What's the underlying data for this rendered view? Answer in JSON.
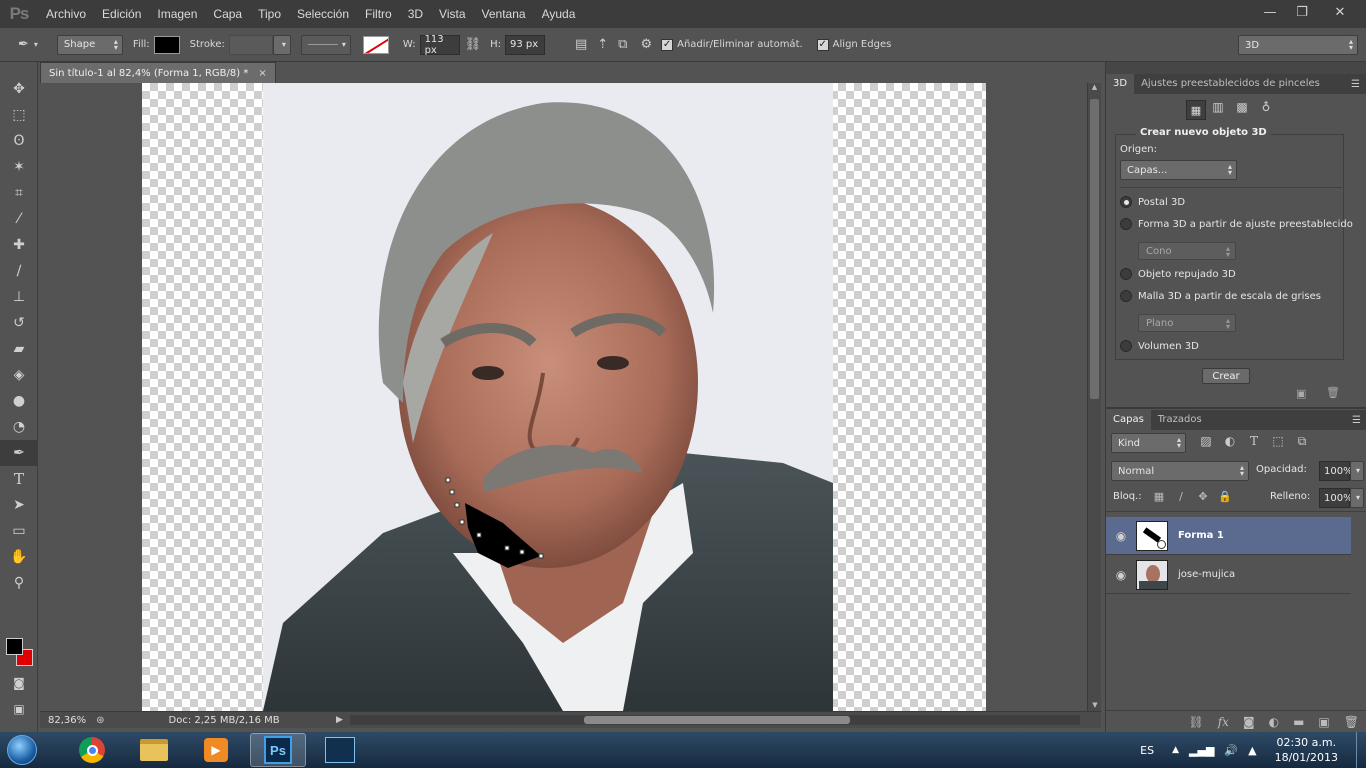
{
  "app": {
    "logo": "Ps"
  },
  "menu": [
    "Archivo",
    "Edición",
    "Imagen",
    "Capa",
    "Tipo",
    "Selección",
    "Filtro",
    "3D",
    "Vista",
    "Ventana",
    "Ayuda"
  ],
  "window_controls": {
    "minimize": "—",
    "restore": "❐",
    "close": "✕"
  },
  "options": {
    "mode": "Shape",
    "fill_label": "Fill:",
    "stroke_label": "Stroke:",
    "w_label": "W:",
    "w_value": "113 px",
    "h_label": "H:",
    "h_value": "93 px",
    "auto_add_label": "Añadir/Eliminar automát.",
    "align_edges_label": "Align Edges",
    "workspace": "3D",
    "fill_color": "#000000"
  },
  "document": {
    "tab_title": "Sin título-1 al 82,4% (Forma 1, RGB/8) *",
    "tab_close": "×",
    "zoom": "82,36%",
    "doc_info": "Doc: 2,25 MB/2,16 MB"
  },
  "colors": {
    "foreground": "#000000",
    "background": "#e00000",
    "accent": "#5b6a8f"
  },
  "panel3d": {
    "tabs": [
      "3D",
      "Ajustes preestablecidos de pinceles"
    ],
    "section_title": "Crear nuevo objeto 3D",
    "origin_label": "Origen:",
    "origin_value": "Capas...",
    "options": [
      {
        "label": "Postal 3D",
        "selected": true
      },
      {
        "label": "Forma 3D a partir de ajuste preestablecido",
        "selected": false
      },
      {
        "label": "Objeto repujado 3D",
        "selected": false
      },
      {
        "label": "Malla 3D a partir de escala de grises",
        "selected": false
      },
      {
        "label": "Volumen 3D",
        "selected": false
      }
    ],
    "preset_value": "Cono",
    "mesh_value": "Plano",
    "create_button": "Crear"
  },
  "layers": {
    "tabs": [
      "Capas",
      "Trazados"
    ],
    "kind": "Kind",
    "blend_mode": "Normal",
    "opacity_label": "Opacidad:",
    "opacity_value": "100%",
    "lock_label": "Bloq.:",
    "fill_label": "Relleno:",
    "fill_value": "100%",
    "items": [
      {
        "name": "Forma 1",
        "selected": true
      },
      {
        "name": "jose-mujica",
        "selected": false
      }
    ]
  },
  "taskbar": {
    "language": "ES",
    "time": "02:30 a.m.",
    "date": "18/01/2013"
  }
}
